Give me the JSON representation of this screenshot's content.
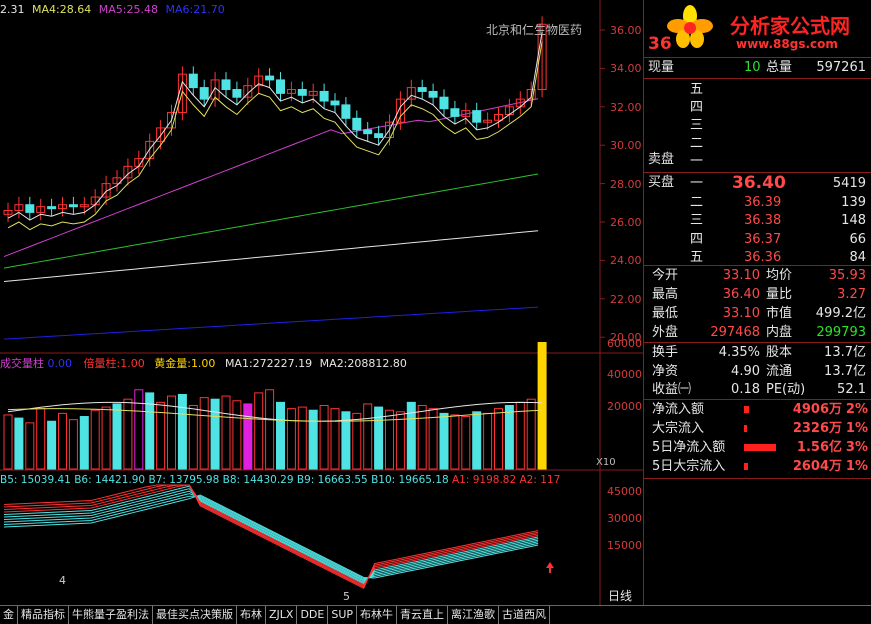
{
  "price_header": {
    "ma3": "2.31",
    "ma4_label": "MA4:",
    "ma4": "28.64",
    "ma5_label": "MA5:",
    "ma5": "25.48",
    "ma6_label": "MA6:",
    "ma6": "21.70",
    "stock_name": "北京和仁",
    "stock_suffix": "生物医药"
  },
  "price_axis": [
    "36.00",
    "34.00",
    "32.00",
    "30.00",
    "28.00",
    "26.00",
    "24.00",
    "22.00",
    "20.00"
  ],
  "volume_header": {
    "name": "成交量柱",
    "v1": "0.00",
    "beiliang_label": "倍量柱:",
    "beiliang": "1.00",
    "huangjin_label": "黄金量:",
    "huangjin": "1.00",
    "ma1_label": "MA1:",
    "ma1": "272227.19",
    "ma2_label": "MA2:",
    "ma2": "208812.80"
  },
  "volume_axis": [
    "60000",
    "40000",
    "20000"
  ],
  "volume_unit": "X10",
  "b_header": {
    "b5": "B5: 15039.41",
    "b6": "B6: 14421.90",
    "b7": "B7: 13795.98",
    "b8": "B8: 14430.29",
    "b9": "B9: 16663.55",
    "b10": "B10: 19665.18",
    "a1": "A1: 9198.82",
    "a2": "A2: 117"
  },
  "b_axis": [
    "45000",
    "30000",
    "15000"
  ],
  "date_marks": [
    "4",
    "5"
  ],
  "period": "日线",
  "logo": {
    "text": "分析家公式网",
    "url": "www.88gs.com"
  },
  "quote": {
    "price_tag": "36",
    "xianliang_label": "现量",
    "xianliang": "10",
    "zongliang_label": "总量",
    "zongliang": "597261",
    "sell_label": "卖盘",
    "sell_levels": [
      "五",
      "四",
      "三",
      "二",
      "一"
    ],
    "buy_label": "买盘",
    "buy": [
      {
        "lvl": "一",
        "price": "36.40",
        "vol": "5419"
      },
      {
        "lvl": "二",
        "price": "36.39",
        "vol": "139"
      },
      {
        "lvl": "三",
        "price": "36.38",
        "vol": "148"
      },
      {
        "lvl": "四",
        "price": "36.37",
        "vol": "66"
      },
      {
        "lvl": "五",
        "price": "36.36",
        "vol": "84"
      }
    ],
    "stats": [
      {
        "l1": "今开",
        "v1": "33.10",
        "l2": "均价",
        "v2": "35.93",
        "c1": "red",
        "c2": "red"
      },
      {
        "l1": "最高",
        "v1": "36.40",
        "l2": "量比",
        "v2": "3.27",
        "c1": "red",
        "c2": "red"
      },
      {
        "l1": "最低",
        "v1": "33.10",
        "l2": "市值",
        "v2": "499.2亿",
        "c1": "red",
        "c2": "white"
      },
      {
        "l1": "外盘",
        "v1": "297468",
        "l2": "内盘",
        "v2": "299793",
        "c1": "red",
        "c2": "green"
      }
    ],
    "stats2": [
      {
        "l1": "换手",
        "v1": "4.35%",
        "l2": "股本",
        "v2": "13.7亿"
      },
      {
        "l1": "净资",
        "v1": "4.90",
        "l2": "流通",
        "v2": "13.7亿"
      },
      {
        "l1": "收益㈠",
        "v1": "0.18",
        "l2": "PE(动)",
        "v2": "52.1"
      }
    ],
    "flows": [
      {
        "label": "净流入额",
        "bar": 0.15,
        "value": "4906万",
        "pct": "2%"
      },
      {
        "label": "大宗流入",
        "bar": 0.08,
        "value": "2326万",
        "pct": "1%"
      },
      {
        "label": "5日净流入额",
        "bar": 0.9,
        "value": "1.56亿",
        "pct": "3%"
      },
      {
        "label": "5日大宗流入",
        "bar": 0.1,
        "value": "2604万",
        "pct": "1%"
      }
    ]
  },
  "tabs": [
    "金",
    "精品指标",
    "牛熊量子盈利法",
    "最佳买点决策版",
    "布林",
    "ZJLX",
    "DDE",
    "SUP",
    "布林牛",
    "青云直上",
    "离江渔歌",
    "古道西风"
  ],
  "colors": {
    "up": "#ff3232",
    "down": "#4fe3e3",
    "ma_white": "#e6e6e6",
    "ma_yellow": "#e0e060",
    "ma_magenta": "#d040d0",
    "ma_green": "#30c030",
    "ma_blue": "#2020e0",
    "border": "#8a1c1c"
  }
}
